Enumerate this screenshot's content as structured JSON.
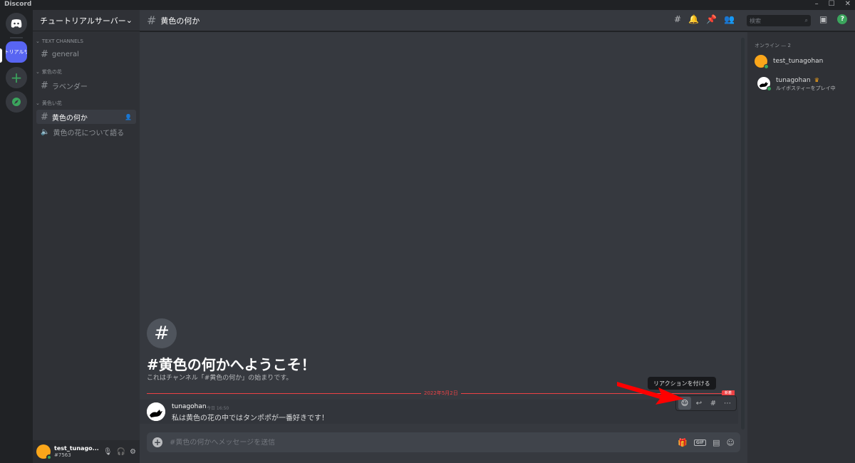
{
  "window": {
    "title": "Discord"
  },
  "server": {
    "active_label": "トリアルサ",
    "name": "チュートリアルサーバー"
  },
  "categories": [
    {
      "name": "TEXT CHANNELS",
      "channels": [
        {
          "name": "general",
          "type": "text"
        }
      ]
    },
    {
      "name": "紫色の花",
      "channels": [
        {
          "name": "ラベンダー",
          "type": "text"
        }
      ]
    },
    {
      "name": "黄色い花",
      "channels": [
        {
          "name": "黄色の何か",
          "type": "text",
          "selected": true
        },
        {
          "name": "黄色の花について語る",
          "type": "voice"
        }
      ]
    }
  ],
  "user": {
    "name": "test_tunago...",
    "tag": "#7563"
  },
  "chat_header": {
    "channel": "黄色の何か",
    "search_placeholder": "検索"
  },
  "welcome": {
    "title": "#黄色の何かへようこそ！",
    "subtitle": "これはチャンネル「#黄色の何か」の始まりです。"
  },
  "divider_date": "2022年5月2日",
  "new_badge": "新着",
  "message": {
    "author": "tunagohan",
    "time": "今日 16:50",
    "text": "私は黄色の花の中ではタンポポが一番好きです！"
  },
  "tooltip": "リアクションを付ける",
  "composer": {
    "placeholder": "#黄色の何かへメッセージを送信"
  },
  "members": {
    "category": "オンライン — 2",
    "list": [
      {
        "name": "test_tunagohan",
        "activity": ""
      },
      {
        "name": "tunagohan",
        "activity": "ルイボスティーをプレイ中"
      }
    ]
  },
  "colors": {
    "accent": "#5865f2",
    "online": "#3ba55d",
    "danger": "#ed4245",
    "owner": "#faa61a"
  }
}
